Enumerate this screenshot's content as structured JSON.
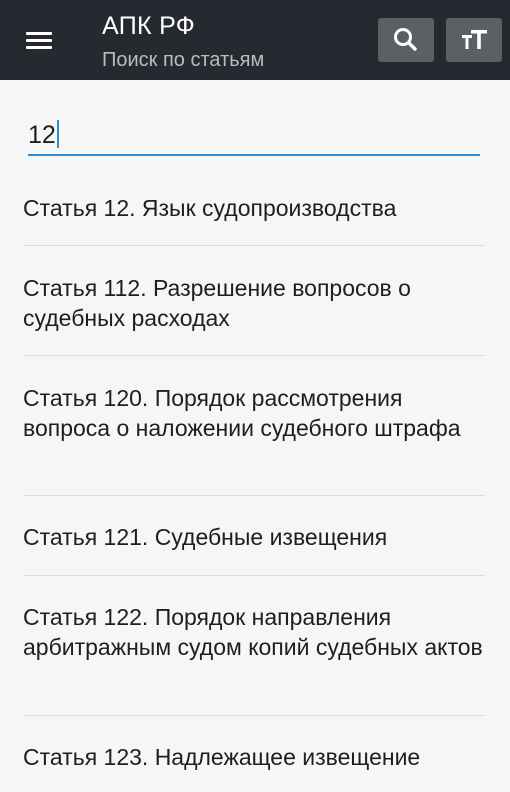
{
  "toolbar": {
    "menu_icon": "hamburger-menu-icon",
    "title": "АПК РФ",
    "subtitle": "Поиск по статьям",
    "search_icon": "search-icon",
    "text_size_icon": "text-size-icon",
    "background": "#262a30"
  },
  "search": {
    "value": "12",
    "accent": "#2b8fd6"
  },
  "results": [
    {
      "label": "Статья 12. Язык судопроизводства"
    },
    {
      "label": "Статья 112. Разрешение вопросов о судебных расходах"
    },
    {
      "label": "Статья 120. Порядок рассмотрения вопроса о наложении судебного штрафа"
    },
    {
      "label": "Статья 121. Судебные извещения"
    },
    {
      "label": "Статья 122. Порядок направления арбитражным судом копий судебных актов"
    },
    {
      "label": "Статья 123. Надлежащее извещение"
    }
  ]
}
